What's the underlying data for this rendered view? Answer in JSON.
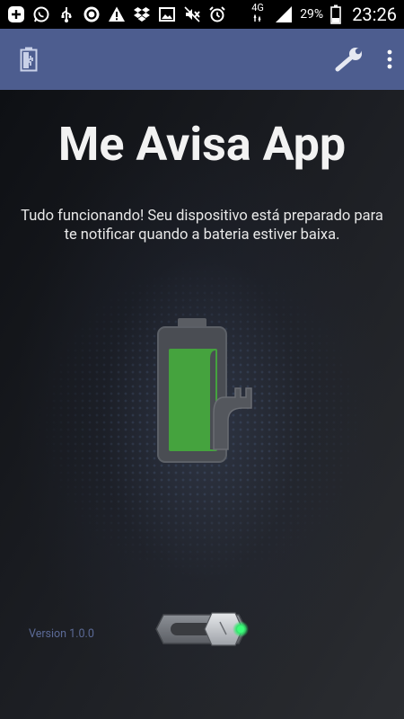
{
  "status_bar": {
    "icons_left": [
      "add-icon",
      "whatsapp-icon",
      "usb-icon",
      "circle-app-icon",
      "warning-icon",
      "dropbox-icon",
      "image-icon",
      "mute-icon",
      "alarm-icon"
    ],
    "network_label": "4G",
    "battery_percent": "29%",
    "time": "23:26"
  },
  "appbar": {
    "colors": {
      "background": "#4d5d8f"
    },
    "icons": [
      "battery-charging-icon",
      "wrench-icon",
      "overflow-menu-icon"
    ]
  },
  "main": {
    "title": "Me Avisa App",
    "description": "Tudo funcionando! Seu dispositivo está preparado para te notificar quando a bateria estiver baixa.",
    "version": "Version 1.0.0",
    "toggle": {
      "state": "on",
      "indicator_color": "#2ee86a"
    }
  }
}
